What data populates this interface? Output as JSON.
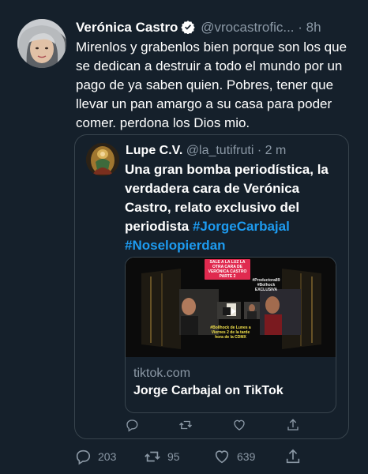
{
  "tweet": {
    "author_name": "Verónica Castro",
    "author_handle": "@vrocastrofic...",
    "separator": "·",
    "time": "8h",
    "more_label": "···",
    "text": "Mirenlos y grabenlos bien porque son los que se dedican a destruir a todo el mundo por un pago de ya saben quien. Pobres, tener que llevar un pan amargo a su casa para poder comer. perdona los Dios mio."
  },
  "quote": {
    "author_name": "Lupe C.V.",
    "author_handle": "@la_tutifruti",
    "separator": "·",
    "time": "2 m",
    "text_part1": "Una gran bomba periodística, la verdadera cara de ",
    "text_bold_name": "Verónica Castro",
    "text_part2": ", relato exclusivo del periodista ",
    "hashtag1": "#JorgeCarbajal",
    "hashtag2": "#Noselopierdan",
    "card": {
      "domain": "tiktok.com",
      "title": "Jorge Carbajal on TikTok",
      "image_banner": "SALE A LA LUZ LA OTRA CARA DE VERÓNICA CASTRO PARTE 2",
      "image_caption": "#Bollhock de Lunes a Viernes 2 de la tarde hora de la CDMX",
      "image_tags": "#Productora89 #Bolhock EXCLUSIVA"
    }
  },
  "actions": {
    "replies": "203",
    "retweets": "95",
    "likes": "639"
  },
  "colors": {
    "background": "#15202b",
    "text_secondary": "#8b98a5",
    "accent": "#1d9bf0",
    "border": "#38444d"
  }
}
